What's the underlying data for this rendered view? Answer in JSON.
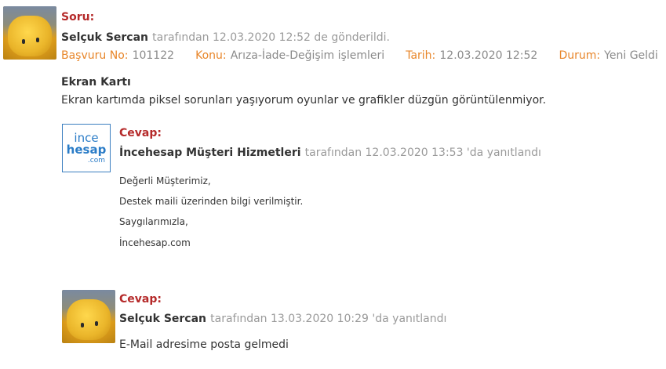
{
  "question": {
    "heading": "Soru:",
    "author": "Selçuk Sercan",
    "sent_text": "tarafından 12.03.2020 12:52 de gönderildi.",
    "details": {
      "application_label": "Başvuru No:",
      "application_value": "101122",
      "subject_label": "Konu:",
      "subject_value": "Arıza-İade-Değişim işlemleri",
      "date_label": "Tarih:",
      "date_value": "12.03.2020 12:52",
      "status_label": "Durum:",
      "status_value": "Yeni Geldi"
    },
    "title": "Ekran Kartı",
    "body": "Ekran kartımda piksel sorunları yaşıyorum oyunlar ve grafikler düzgün görüntülenmiyor."
  },
  "replies": [
    {
      "heading": "Cevap:",
      "author": "İncehesap Müşteri Hizmetleri",
      "meta": "tarafından 12.03.2020 13:53 'da yanıtlandı",
      "logo": {
        "line1": "ince",
        "line2": "hesap",
        "line3": ".com"
      },
      "lines": [
        "Değerli Müşterimiz,",
        "Destek maili üzerinden bilgi verilmiştir.",
        "Saygılarımızla,",
        "İncehesap.com"
      ]
    },
    {
      "heading": "Cevap:",
      "author": "Selçuk Sercan",
      "meta": "tarafından 13.03.2020 10:29 'da yanıtlandı",
      "body": "E-Mail adresime posta gelmedi"
    }
  ]
}
